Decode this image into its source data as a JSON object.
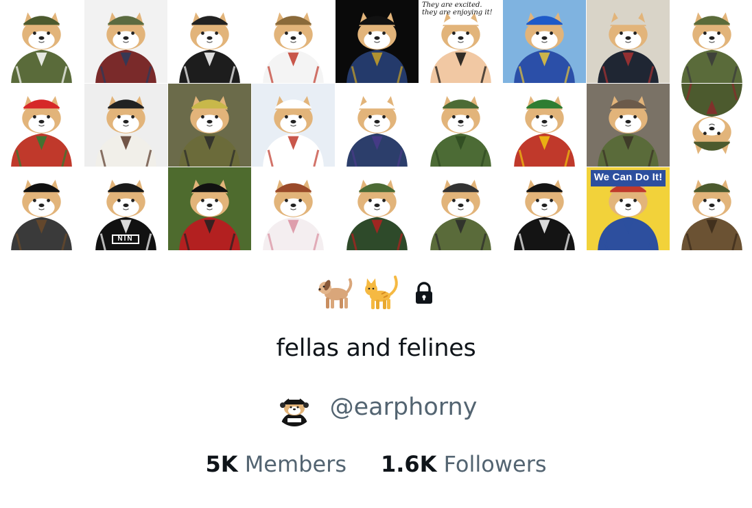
{
  "banner": {
    "tiles": [
      {
        "name": "cheems-camo-cap",
        "bg": "#ffffff",
        "outfit": "#5a6b3a",
        "hat": "#4c5a2e",
        "accent": "#ffffff"
      },
      {
        "name": "cheems-rifle-kit",
        "bg": "#f2f2f2",
        "outfit": "#7a2a2a",
        "hat": "#5b6b40",
        "accent": "#2a3b5c"
      },
      {
        "name": "cheems-helmet-tracksuit",
        "bg": "#ffffff",
        "outfit": "#1d1d1d",
        "hat": "#222222",
        "accent": "#ffffff"
      },
      {
        "name": "cheems-cossack",
        "bg": "#ffffff",
        "outfit": "#f4f4f4",
        "hat": "#8a6a3a",
        "accent": "#c0392b"
      },
      {
        "name": "cheems-pirate",
        "bg": "#0a0a0a",
        "outfit": "#243a6b",
        "hat": "#111111",
        "accent": "#c9a227"
      },
      {
        "name": "cheems-excited-meme",
        "bg": "#ffffff",
        "outfit": "#f1c8a3",
        "hat": "#ffffff",
        "accent": "#111111"
      },
      {
        "name": "cheems-blue-cap",
        "bg": "#7fb3e0",
        "outfit": "#2b4fa8",
        "hat": "#1e5ac8",
        "accent": "#e8c53a"
      },
      {
        "name": "cheems-office-suit",
        "bg": "#d9d4c8",
        "outfit": "#1f2633",
        "hat": "#d9d4c8",
        "accent": "#a83232"
      },
      {
        "name": "cheems-soldier-rifle",
        "bg": "#ffffff",
        "outfit": "#5a6b3a",
        "hat": "#5b6b3a",
        "accent": "#3a3a3a"
      },
      {
        "name": "cheems-flower-crown",
        "bg": "#ffffff",
        "outfit": "#c0392b",
        "hat": "#d62828",
        "accent": "#2e7d32"
      },
      {
        "name": "cheems-white-shirt",
        "bg": "#eeeeee",
        "outfit": "#f1efe9",
        "hat": "#222222",
        "accent": "#5a3a2a"
      },
      {
        "name": "cheems-camo-photo",
        "bg": "#6b6b4a",
        "outfit": "#6b6b3a",
        "hat": "#c8b84a",
        "accent": "#2a2a2a"
      },
      {
        "name": "cheems-sailor-pair",
        "bg": "#e8eef5",
        "outfit": "#ffffff",
        "hat": "#ffffff",
        "accent": "#c0392b"
      },
      {
        "name": "cheems-business-suit",
        "bg": "#ffffff",
        "outfit": "#2c3e6b",
        "hat": "#ffffff",
        "accent": "#4a3a8a"
      },
      {
        "name": "cheems-camo-jacket",
        "bg": "#ffffff",
        "outfit": "#4c6b35",
        "hat": "#4c6b35",
        "accent": "#2e4a20"
      },
      {
        "name": "cheems-red-jacket",
        "bg": "#ffffff",
        "outfit": "#c0392b",
        "hat": "#2e7d32",
        "accent": "#f1c40f"
      },
      {
        "name": "cheems-tunnel",
        "bg": "#7a7266",
        "outfit": "#5a6b3a",
        "hat": "#6b5a4a",
        "accent": "#3a3226"
      },
      {
        "name": "cheems-upside-down",
        "bg": "#ffffff",
        "outfit": "#4c5a2e",
        "hat": "#4c5a2e",
        "accent": "#8a2a2a"
      },
      {
        "name": "cheems-black-cap",
        "bg": "#ffffff",
        "outfit": "#3a3a3a",
        "hat": "#111111",
        "accent": "#6b4a2a"
      },
      {
        "name": "cheems-nin-headphones",
        "bg": "#ffffff",
        "outfit": "#111111",
        "hat": "#1a1a1a",
        "accent": "#ffffff"
      },
      {
        "name": "cheems-guard-uniform",
        "bg": "#4e6b2e",
        "outfit": "#b32020",
        "hat": "#111111",
        "accent": "#222222"
      },
      {
        "name": "cheems-redhead",
        "bg": "#ffffff",
        "outfit": "#f4eef0",
        "hat": "#9a4a2a",
        "accent": "#d98fa0"
      },
      {
        "name": "cheems-camo-helmet",
        "bg": "#ffffff",
        "outfit": "#2e4a2a",
        "hat": "#4c6b35",
        "accent": "#b32020"
      },
      {
        "name": "cheems-gas-mask",
        "bg": "#ffffff",
        "outfit": "#5a6b3a",
        "hat": "#333333",
        "accent": "#2a2a2a"
      },
      {
        "name": "cheems-black-tracksuit",
        "bg": "#ffffff",
        "outfit": "#141414",
        "hat": "#141414",
        "accent": "#ffffff"
      },
      {
        "name": "cheems-we-can-do-it",
        "bg": "#f2d23a",
        "outfit": "#2d4f9e",
        "hat": "#c0392b",
        "accent": "#2d4f9e"
      },
      {
        "name": "cheems-officer-rifle",
        "bg": "#ffffff",
        "outfit": "#6b5233",
        "hat": "#4c5a2e",
        "accent": "#3a2a1a"
      }
    ],
    "meme_caption": "They are excited.\nthey are enjoying it!",
    "poster_caption": "We Can Do It!",
    "nin_logo": "NIN"
  },
  "list": {
    "dog_emoji_icon": "dog-icon",
    "cat_emoji_icon": "cat-icon",
    "lock_icon": "lock-icon",
    "name": "fellas and felines",
    "owner_handle": "@earphorny",
    "members_count": "5K",
    "members_label": "Members",
    "followers_count": "1.6K",
    "followers_label": "Followers"
  },
  "colors": {
    "text_primary": "#0f1419",
    "text_secondary": "#536471",
    "cheems_fur": "#e2b47a",
    "cheems_face": "#ffffff"
  }
}
